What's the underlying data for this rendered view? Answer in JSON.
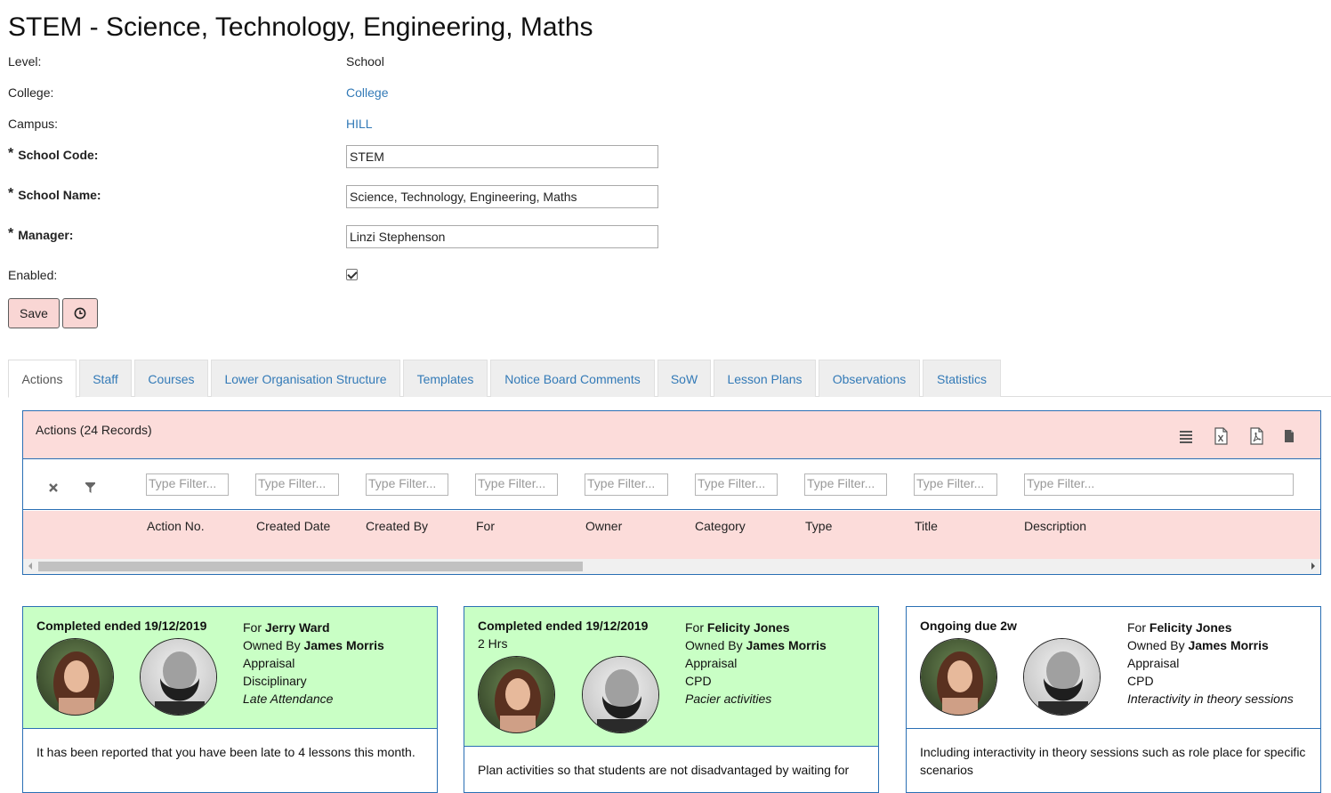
{
  "page": {
    "title": "STEM - Science, Technology, Engineering, Maths"
  },
  "form": {
    "level": {
      "label": "Level:",
      "value": "School"
    },
    "college": {
      "label": "College:",
      "value": "College"
    },
    "campus": {
      "label": "Campus:",
      "value": "HILL"
    },
    "school_code": {
      "label": "School Code:",
      "value": "STEM"
    },
    "school_name": {
      "label": "School Name:",
      "value": "Science, Technology, Engineering, Maths"
    },
    "manager": {
      "label": "Manager:",
      "value": "Linzi Stephenson"
    },
    "enabled": {
      "label": "Enabled:",
      "checked": true
    },
    "required_marker": "*",
    "save_label": "Save",
    "history_icon": "clock-icon"
  },
  "tabs": [
    {
      "label": "Actions",
      "active": true
    },
    {
      "label": "Staff"
    },
    {
      "label": "Courses"
    },
    {
      "label": "Lower Organisation Structure"
    },
    {
      "label": "Templates"
    },
    {
      "label": "Notice Board Comments"
    },
    {
      "label": "SoW"
    },
    {
      "label": "Lesson Plans"
    },
    {
      "label": "Observations"
    },
    {
      "label": "Statistics"
    }
  ],
  "grid": {
    "title": "Actions (24 Records)",
    "tools": [
      "column-chooser-icon",
      "excel-export-icon",
      "pdf-export-icon",
      "file-export-icon"
    ],
    "filter_placeholder": "Type Filter...",
    "columns": [
      "Action No.",
      "Created Date",
      "Created By",
      "For",
      "Owner",
      "Category",
      "Type",
      "Title",
      "Description"
    ]
  },
  "cards": [
    {
      "status": "Completed ended 19/12/2019",
      "duration": "",
      "for_prefix": "For",
      "for_name": "Jerry Ward",
      "owner_prefix": "Owned By",
      "owner_name": "James Morris",
      "category": "Appraisal",
      "type": "Disciplinary",
      "title": "Late Attendance",
      "description": "It has been reported that you have been late to 4 lessons this month."
    },
    {
      "status": "Completed ended 19/12/2019",
      "duration": "2 Hrs",
      "for_prefix": "For",
      "for_name": "Felicity Jones",
      "owner_prefix": "Owned By",
      "owner_name": "James Morris",
      "category": "Appraisal",
      "type": "CPD",
      "title": "Pacier activities",
      "description": "Plan activities so that students are not disadvantaged by waiting for"
    },
    {
      "status": "Ongoing due 2w",
      "duration": "",
      "for_prefix": "For",
      "for_name": "Felicity Jones",
      "owner_prefix": "Owned By",
      "owner_name": "James Morris",
      "category": "Appraisal",
      "type": "CPD",
      "title": "Interactivity in theory sessions",
      "description": "Including interactivity in theory sessions such as role place for specific scenarios"
    }
  ],
  "colors": {
    "card_complete": "#c9ffc5",
    "grid_header": "#fcdcda",
    "link": "#337ab7",
    "border": "#2a6fb4"
  }
}
